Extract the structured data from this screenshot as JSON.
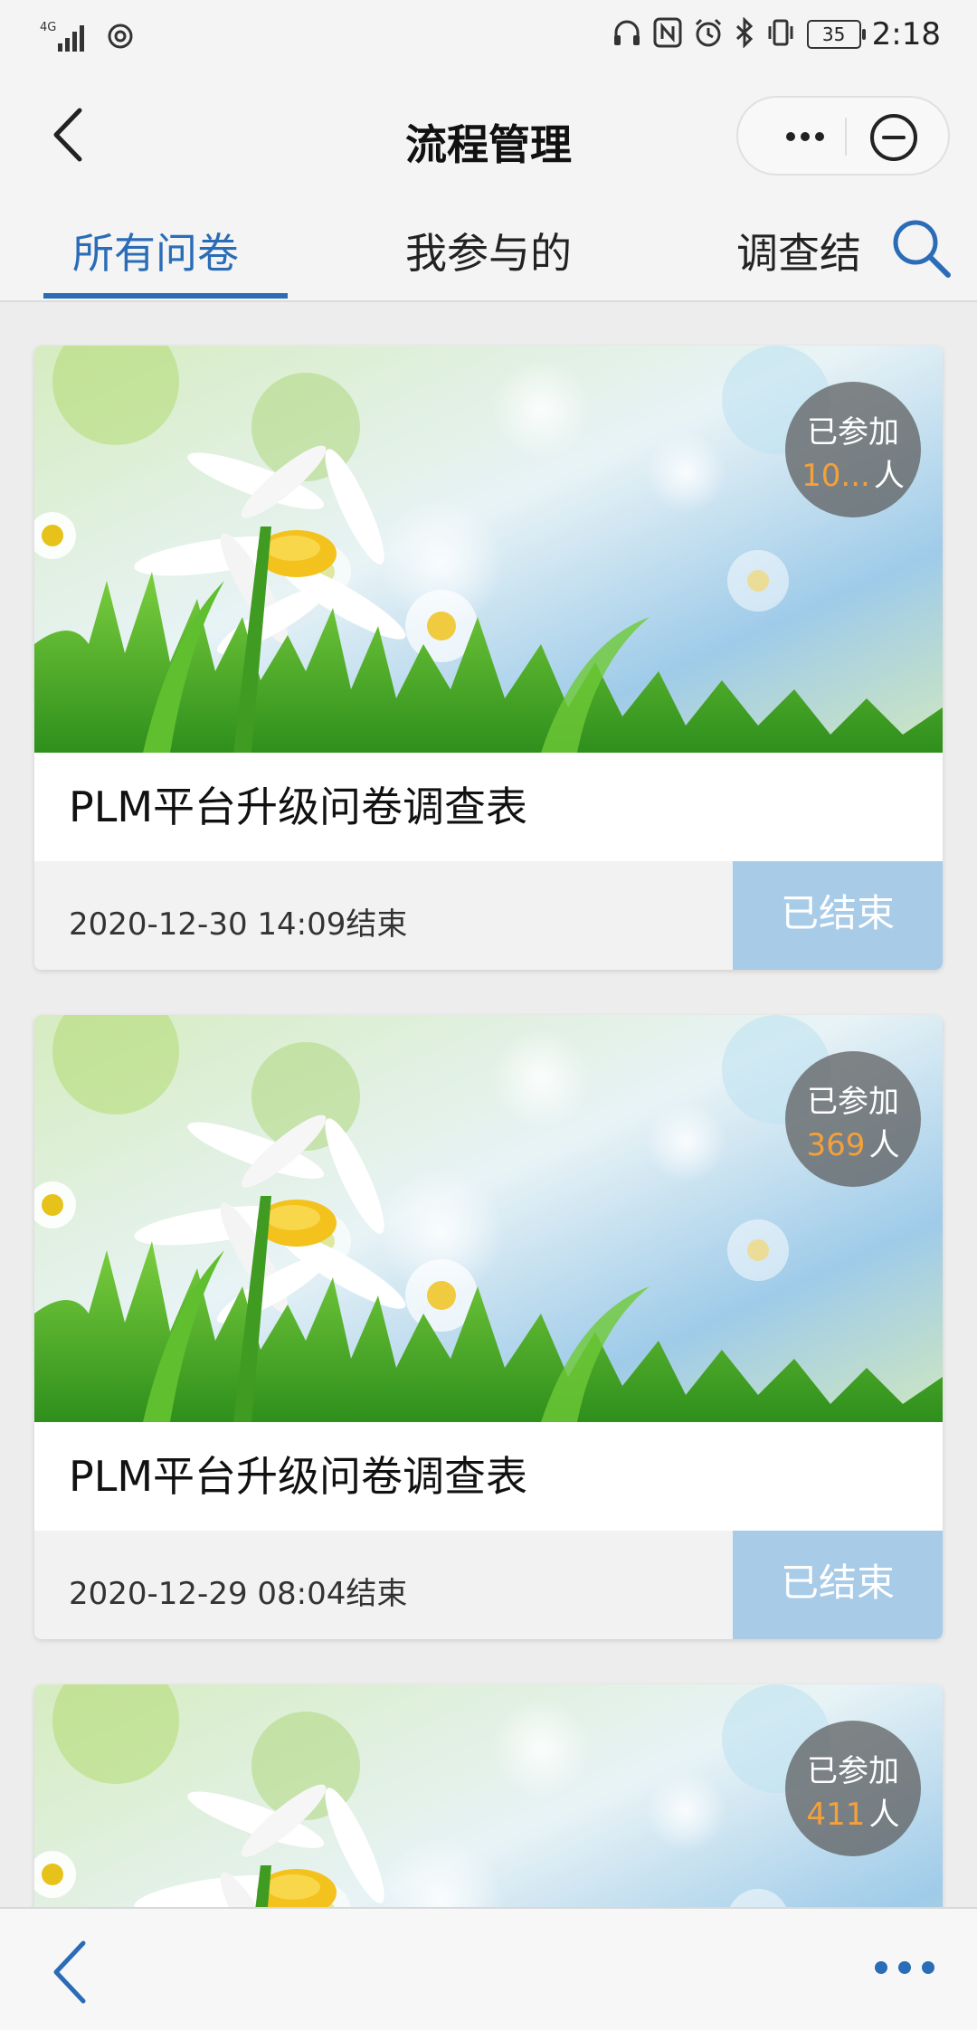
{
  "status_bar": {
    "network": "4G",
    "time": "2:18",
    "battery": "35",
    "icons": [
      "signal-icon",
      "sync-icon",
      "headphones-icon",
      "nfc-icon",
      "alarm-icon",
      "bluetooth-icon",
      "vibrate-icon",
      "battery-icon"
    ]
  },
  "header": {
    "title": "流程管理"
  },
  "tabs": [
    {
      "label": "所有问卷",
      "active": true
    },
    {
      "label": "我参与的",
      "active": false
    },
    {
      "label": "调查结",
      "active": false
    }
  ],
  "cards": [
    {
      "title": "PLM平台升级问卷调查表",
      "badge_label": "已参加",
      "count": "10...",
      "unit": "人",
      "date": "2020-12-30 14:09结束",
      "status": "已结束"
    },
    {
      "title": "PLM平台升级问卷调查表",
      "badge_label": "已参加",
      "count": "369",
      "unit": "人",
      "date": "2020-12-29 08:04结束",
      "status": "已结束"
    },
    {
      "title": "",
      "badge_label": "已参加",
      "count": "411",
      "unit": "人",
      "date": "",
      "status": ""
    }
  ],
  "colors": {
    "accent": "#2b6cb7",
    "count": "#f4a13b",
    "status_bg": "#a8cbe8"
  }
}
